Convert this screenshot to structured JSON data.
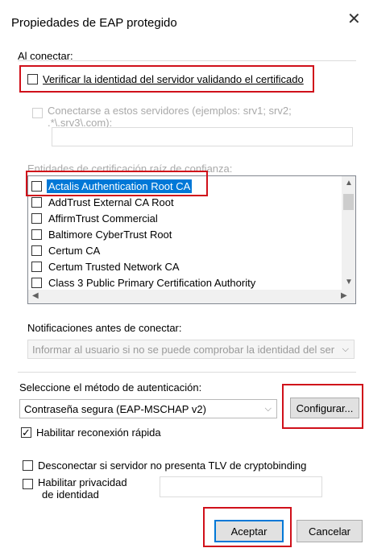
{
  "window": {
    "title": "Propiedades de EAP protegido",
    "close_glyph": "✕"
  },
  "connect": {
    "group_label": "Al conectar:",
    "verify_cert_label": "Verificar la identidad del servidor validando el certificado",
    "connect_servers_label_l1": "Conectarse a estos servidores (ejemplos: srv1; srv2;",
    "connect_servers_label_l2": ".*\\.srv3\\.com):",
    "trusted_ca_label": "Entidades de certificación raíz de confianza:",
    "ca_items": [
      "Actalis Authentication Root CA",
      "AddTrust External CA Root",
      "AffirmTrust Commercial",
      "Baltimore CyberTrust Root",
      "Certum CA",
      "Certum Trusted Network CA",
      "Class 3 Public Primary Certification Authority"
    ],
    "notifications_label": "Notificaciones antes de conectar:",
    "notifications_value": "Informar al usuario si no se puede comprobar la identidad del ser"
  },
  "auth": {
    "method_label": "Seleccione el método de autenticación:",
    "method_value": "Contraseña segura (EAP-MSCHAP v2)",
    "configure_label": "Configurar...",
    "fast_reconnect_label": "Habilitar reconexión rápida",
    "fast_reconnect_checked": true,
    "cryptobinding_label": "Desconectar si servidor no presenta TLV de cryptobinding",
    "privacy_label_l1": "Habilitar privacidad",
    "privacy_label_l2": "de identidad"
  },
  "buttons": {
    "ok_label": "Aceptar",
    "cancel_label": "Cancelar"
  },
  "colors": {
    "highlight_red": "#d0101a",
    "selection_blue": "#0078d7"
  }
}
